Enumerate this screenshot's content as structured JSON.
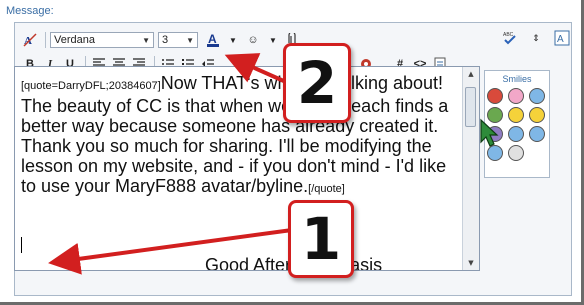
{
  "label": "Message:",
  "toolbar": {
    "font_name": "Verdana",
    "font_size": "3",
    "row1_icons": [
      "remove-format-icon",
      "font-color-icon",
      "smilie-icon",
      "attach-icon"
    ],
    "row2_labels": [
      "B",
      "I",
      "U"
    ],
    "row2_extra": [
      "#",
      "<>",
      ""
    ]
  },
  "editor": {
    "quote_open": "[quote=DarryDFL;20384607]",
    "body": "Now THAT's what I'm talking about! The beauty of CC is that when we share, each finds a better way because someone has already created it. Thank you so much for sharing. I'll be modifying the lesson on my website, and - if you don't mind - I'd like to use your MaryF888 avatar/byline.",
    "quote_close": "[/quote]",
    "next_line": "Good Afternoon Oasis"
  },
  "smilies": {
    "title": "Smilies",
    "colors": [
      "#d94a3b",
      "#f2a7c8",
      "#7fb7e6",
      "#6aa84f",
      "#f5d23a",
      "#f5d23a",
      "#8e7cc3",
      "#7fb7e6",
      "#7fb7e6",
      "#7fb7e6",
      "#e0e0e0"
    ]
  },
  "callouts": {
    "first": "1",
    "second": "2"
  },
  "colors": {
    "callout_border": "#d21f1f",
    "arrow": "#d21f1f",
    "label": "#3a6ea5"
  }
}
